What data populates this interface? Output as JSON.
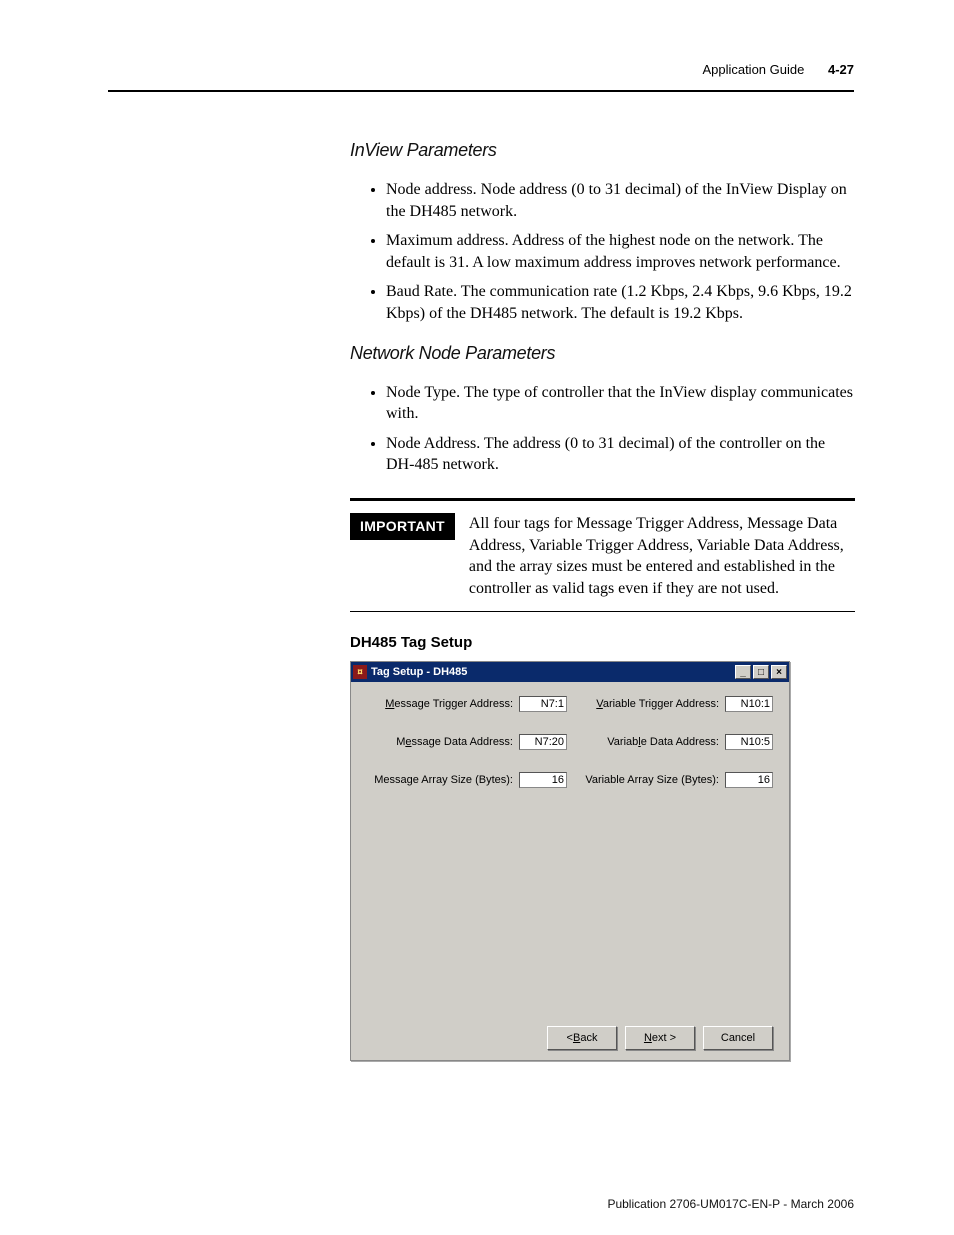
{
  "header": {
    "section": "Application Guide",
    "page": "4-27"
  },
  "sections": {
    "inview": {
      "title": "InView Parameters",
      "items": [
        "Node address. Node address (0 to 31 decimal) of the InView Display on the DH485 network.",
        "Maximum address. Address of the highest node on the network. The default is 31. A low maximum address improves network performance.",
        "Baud Rate. The communication rate (1.2 Kbps, 2.4 Kbps, 9.6 Kbps, 19.2 Kbps) of the DH485 network. The default is 19.2 Kbps."
      ]
    },
    "network": {
      "title": "Network Node Parameters",
      "items": [
        "Node Type. The type of controller that the InView display communicates with.",
        "Node Address. The address (0 to 31 decimal) of the controller on the DH-485 network."
      ]
    }
  },
  "important": {
    "label": "IMPORTANT",
    "text": "All four tags for Message Trigger Address, Message Data Address, Variable Trigger Address, Variable Data Address, and the array sizes must be entered and established in the controller as valid tags even if they are not used."
  },
  "tag_setup": {
    "heading": "DH485 Tag Setup",
    "dialog_title": "Tag Setup - DH485",
    "fields": {
      "msg_trigger": {
        "label": "Message Trigger Address:",
        "value": "N7:1"
      },
      "var_trigger": {
        "label": "Variable Trigger Address:",
        "value": "N10:1"
      },
      "msg_data": {
        "label": "Message Data Address:",
        "value": "N7:20"
      },
      "var_data": {
        "label": "Variable Data Address:",
        "value": "N10:5"
      },
      "msg_array": {
        "label": "Message Array Size (Bytes):",
        "value": "16"
      },
      "var_array": {
        "label": "Variable Array Size (Bytes):",
        "value": "16"
      }
    },
    "buttons": {
      "back": "< Back",
      "next": "Next >",
      "cancel": "Cancel"
    }
  },
  "footer": "Publication 2706-UM017C-EN-P - March 2006"
}
